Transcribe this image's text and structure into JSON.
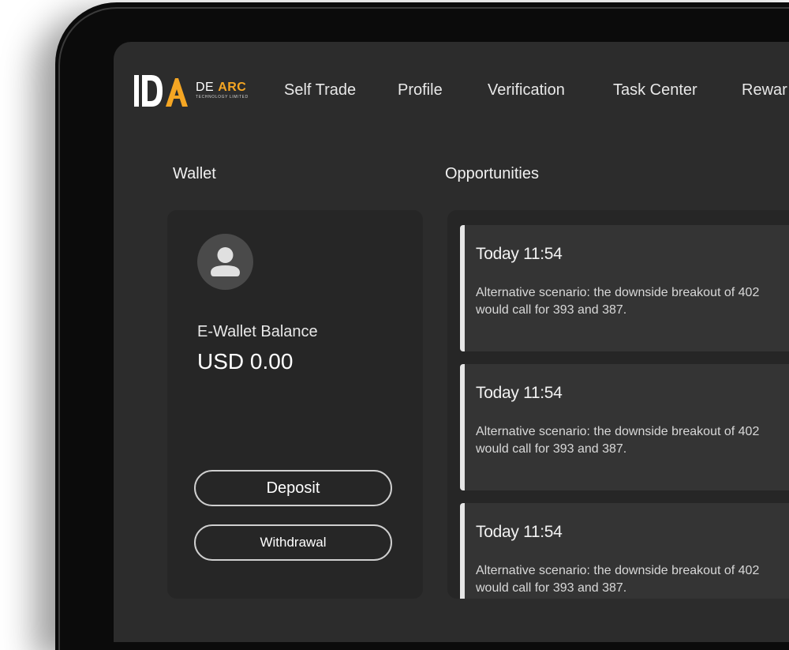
{
  "brand": {
    "logo_mark": "DA",
    "name_part1": "DE",
    "name_part2": "ARC",
    "tagline": "TECHNOLOGY LIMITED",
    "colors": {
      "white": "#ffffff",
      "accent": "#f5a623"
    }
  },
  "nav": {
    "items": [
      {
        "label": "Self Trade"
      },
      {
        "label": "Profile"
      },
      {
        "label": "Verification"
      },
      {
        "label": "Task Center"
      },
      {
        "label": "Rewar"
      }
    ]
  },
  "wallet": {
    "section_title": "Wallet",
    "avatar_icon": "user-avatar-icon",
    "balance_label": "E-Wallet Balance",
    "balance_value": "USD 0.00",
    "deposit_label": "Deposit",
    "withdraw_label": "Withdrawal"
  },
  "opportunities": {
    "section_title": "Opportunities",
    "items": [
      {
        "time": "Today 11:54",
        "text": "Alternative scenario: the downside breakout of 402 would call for 393 and 387."
      },
      {
        "time": "Today 11:54",
        "text": "Alternative scenario: the downside breakout of 402 would call for 393 and 387."
      },
      {
        "time": "Today 11:54",
        "text": "Alternative scenario: the downside breakout of 402 would call for 393 and 387."
      }
    ]
  },
  "theme": {
    "screen_bg": "#2c2c2c",
    "card_bg": "#262626",
    "item_bg": "#343434"
  }
}
